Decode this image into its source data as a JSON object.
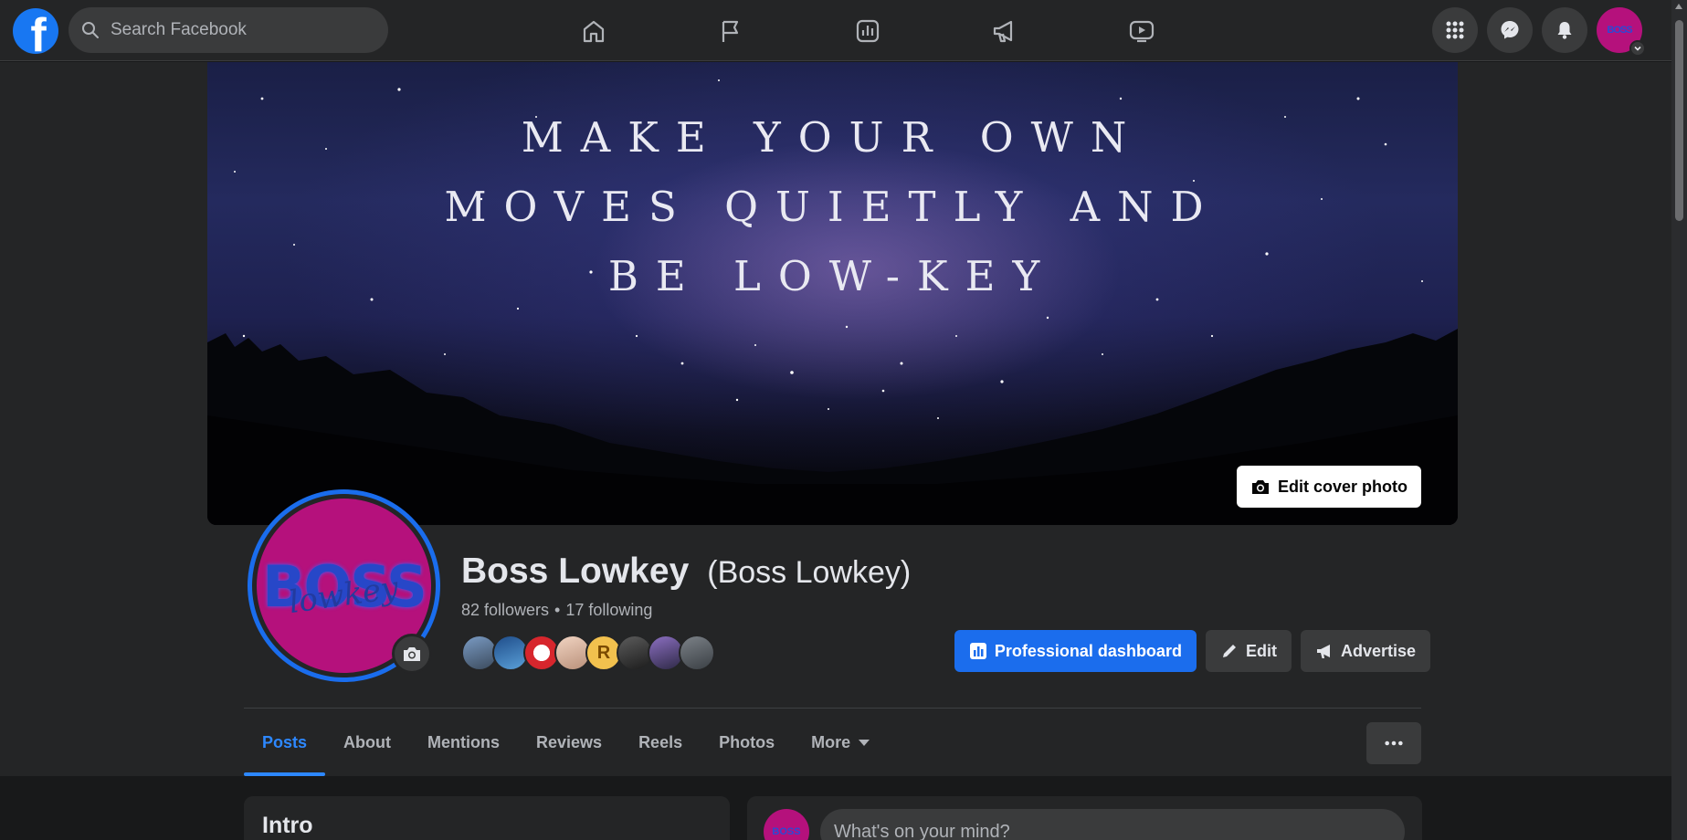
{
  "topbar": {
    "logo_letter": "f",
    "search_placeholder": "Search Facebook",
    "nav_icons": [
      "home-icon",
      "flag-icon",
      "insights-icon",
      "megaphone-icon",
      "watch-icon"
    ],
    "right_icons": [
      "menu-grid-icon",
      "messenger-icon",
      "notifications-icon"
    ],
    "avatar_text": "BOSS"
  },
  "cover": {
    "lines": [
      "MAKE YOUR OWN",
      "MOVES QUIETLY AND",
      "BE LOW-KEY"
    ],
    "edit_label": "Edit cover photo"
  },
  "profile": {
    "pic_text_big": "BOSS",
    "pic_text_script": "lowkey",
    "name": "Boss Lowkey",
    "alt_name": "(Boss Lowkey)",
    "followers": "82 followers",
    "separator": "•",
    "following": "17 following",
    "friend_initial": "R"
  },
  "actions": {
    "dashboard": "Professional dashboard",
    "edit": "Edit",
    "advertise": "Advertise"
  },
  "tabs": [
    "Posts",
    "About",
    "Mentions",
    "Reviews",
    "Reels",
    "Photos",
    "More"
  ],
  "intro": {
    "title": "Intro"
  },
  "composer": {
    "placeholder": "What's on your mind?",
    "avatar_text": "BOSS"
  },
  "colors": {
    "accent": "#2d88ff",
    "primary_button": "#1b6ded",
    "profile_bg": "#b5117c"
  }
}
